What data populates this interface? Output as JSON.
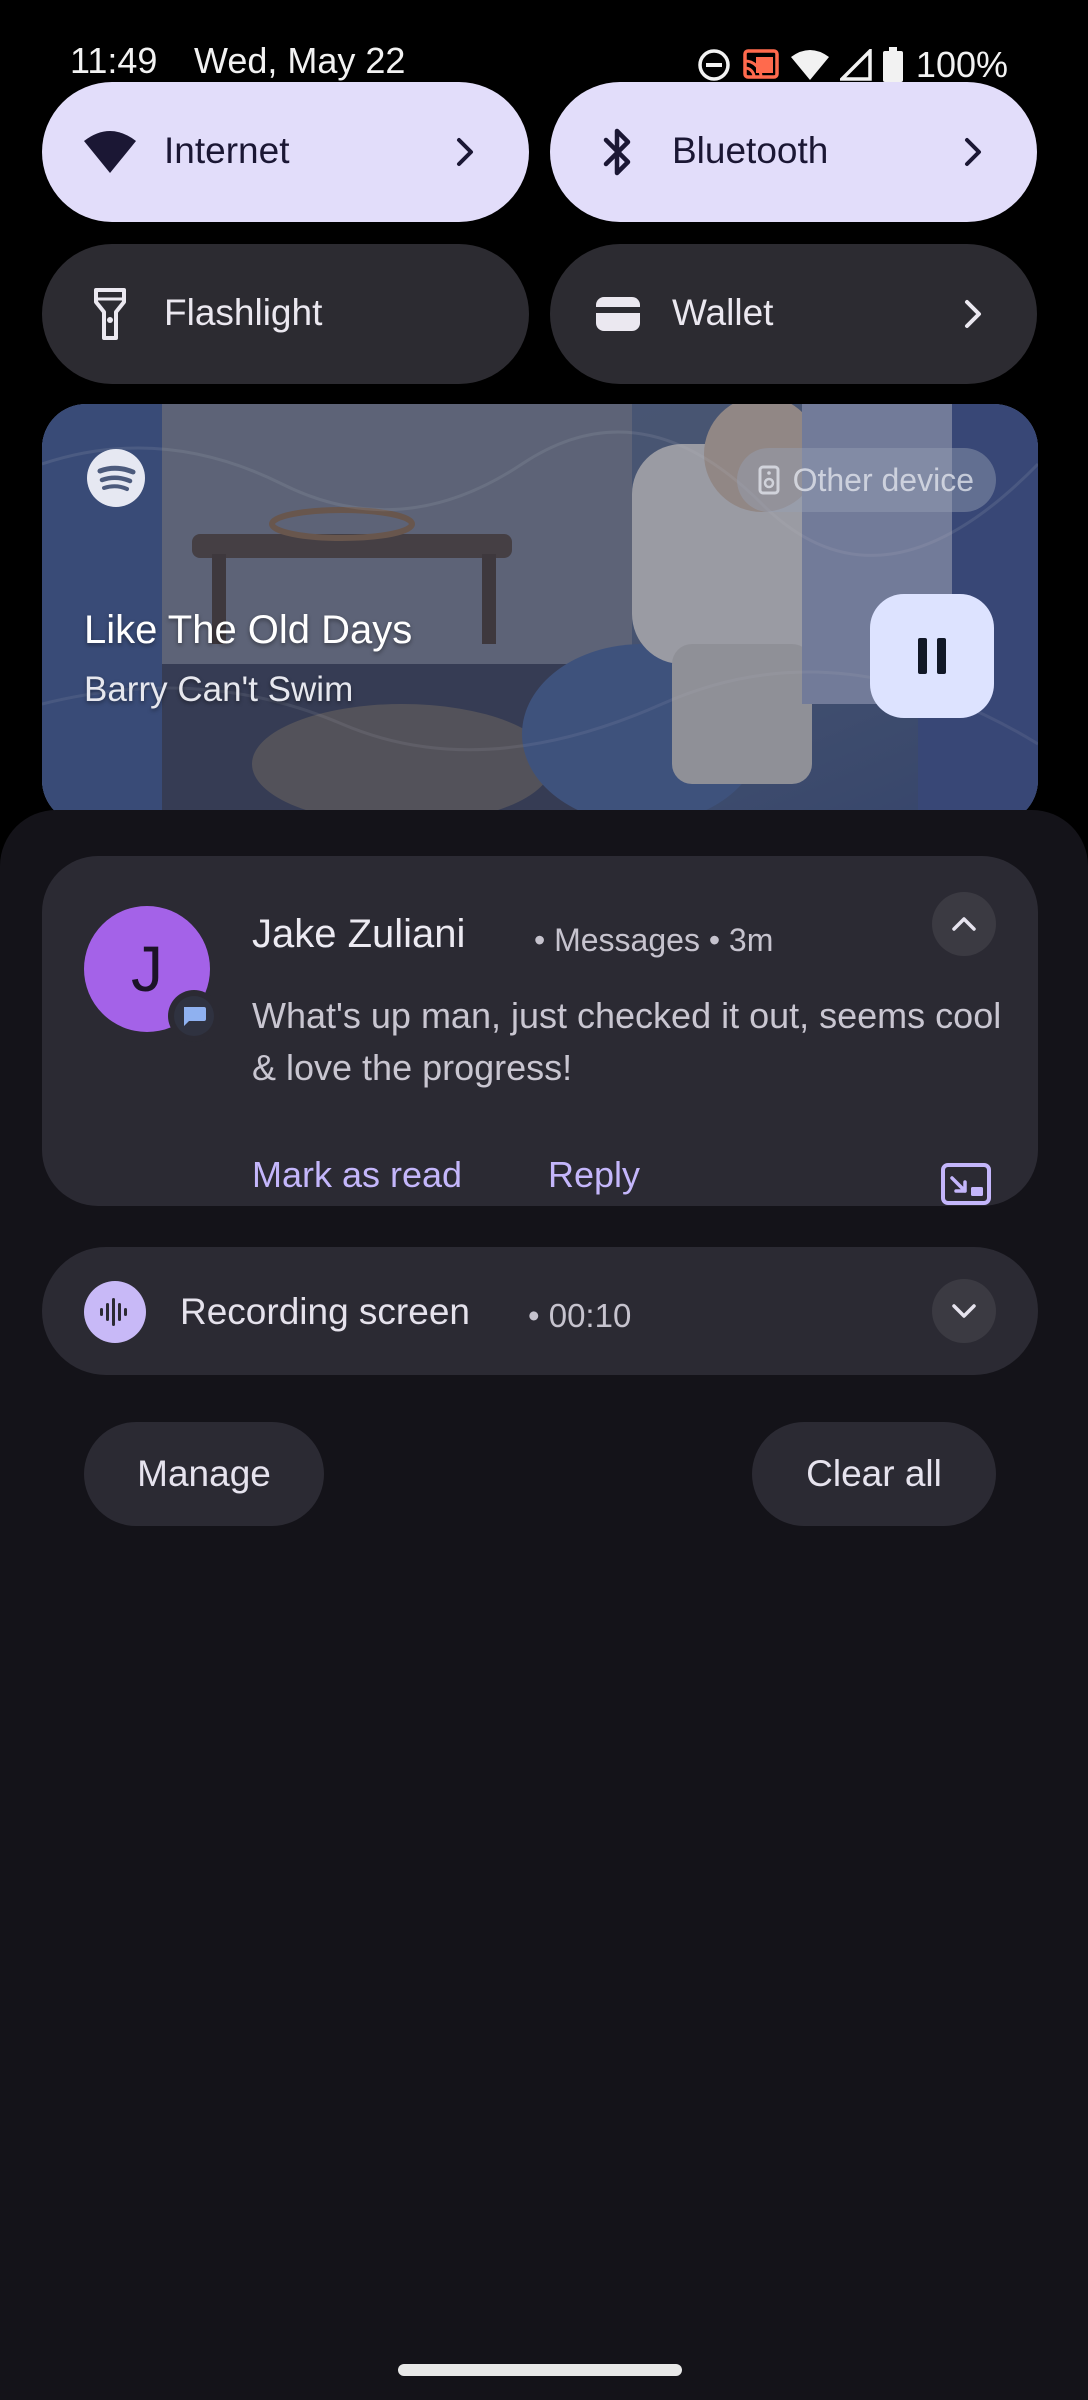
{
  "status_bar": {
    "time": "11:49",
    "date": "Wed, May 22",
    "battery": "100%",
    "icons": [
      "do-not-disturb-icon",
      "cast-icon",
      "wifi-icon",
      "cell-signal-icon",
      "battery-icon"
    ]
  },
  "quick_tiles": [
    {
      "label": "Internet",
      "state": "on",
      "icon": "wifi-icon",
      "has_chevron": true
    },
    {
      "label": "Bluetooth",
      "state": "on",
      "icon": "bluetooth-icon",
      "has_chevron": true
    },
    {
      "label": "Flashlight",
      "state": "off",
      "icon": "flashlight-icon",
      "has_chevron": false
    },
    {
      "label": "Wallet",
      "state": "off",
      "icon": "wallet-icon",
      "has_chevron": true
    }
  ],
  "media": {
    "app_icon": "spotify-icon",
    "device_chip": "Other device",
    "title": "Like The Old Days",
    "artist": "Barry Can't Swim",
    "play_state": "playing"
  },
  "notification": {
    "avatar_letter": "J",
    "sender": "Jake Zuliani",
    "app": "Messages",
    "time_ago": "3m",
    "meta": "• Messages • 3m",
    "message": "What's up man, just checked it out, seems cool & love the progress!",
    "actions": {
      "mark_read": "Mark as read",
      "reply": "Reply"
    }
  },
  "recording": {
    "label": "Recording screen",
    "elapsed": "• 00:10"
  },
  "footer": {
    "manage": "Manage",
    "clear_all": "Clear all"
  },
  "colors": {
    "tile_on": "#e2ddfa",
    "tile_off": "#2c2b31",
    "shade_bg": "#141319",
    "card_bg": "#2b2a33",
    "avatar": "#a462e8",
    "action_text": "#c4b6fb"
  }
}
